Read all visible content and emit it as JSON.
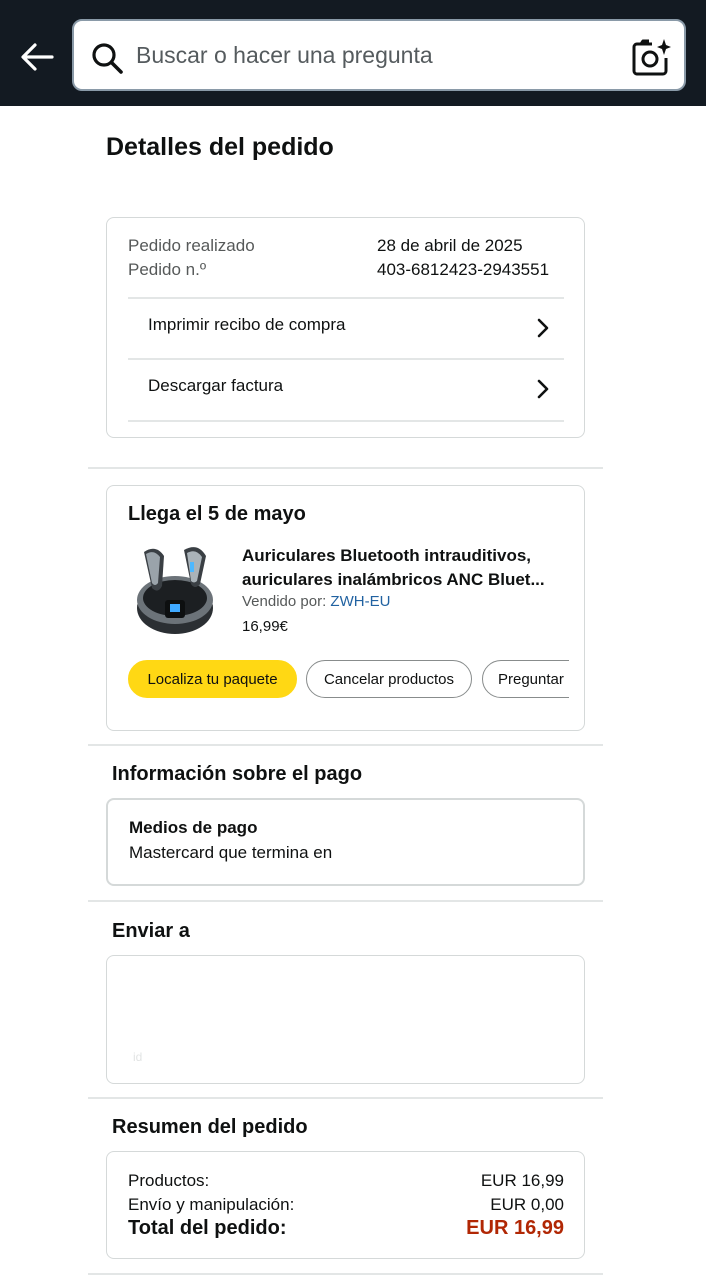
{
  "search": {
    "placeholder": "Buscar o hacer una pregunta"
  },
  "page_title": "Detalles del pedido",
  "order_info": {
    "placed_label": "Pedido realizado",
    "placed_value": "28 de abril de 2025",
    "number_label": "Pedido n.º",
    "number_value": "403-6812423-2943551",
    "print_receipt": "Imprimir recibo de compra",
    "download_invoice": "Descargar factura"
  },
  "delivery": {
    "title": "Llega el 5 de mayo",
    "product_name_line1": "Auriculares Bluetooth intrauditivos,",
    "product_name_line2": "auriculares inalámbricos ANC Bluet...",
    "sold_by_label": "Vendido por:",
    "seller": "ZWH-EU",
    "price": "16,99€",
    "buttons": {
      "track": "Localiza tu paquete",
      "cancel": "Cancelar productos",
      "ask": "Preguntar"
    }
  },
  "payment": {
    "section_title": "Información sobre el pago",
    "method_label": "Medios de pago",
    "method_value": "Mastercard  que termina en"
  },
  "shipping": {
    "section_title": "Enviar a",
    "faint_text": "id"
  },
  "summary": {
    "section_title": "Resumen del pedido",
    "rows": [
      {
        "label": "Productos:",
        "value": "EUR 16,99"
      },
      {
        "label": "Envío y manipulación:",
        "value": "EUR 0,00"
      }
    ],
    "total_label": "Total del pedido:",
    "total_value": "EUR 16,99"
  },
  "colors": {
    "header_bg": "#131a22",
    "primary_button": "#ffd814",
    "link": "#2162a1",
    "total_price": "#b12704"
  }
}
